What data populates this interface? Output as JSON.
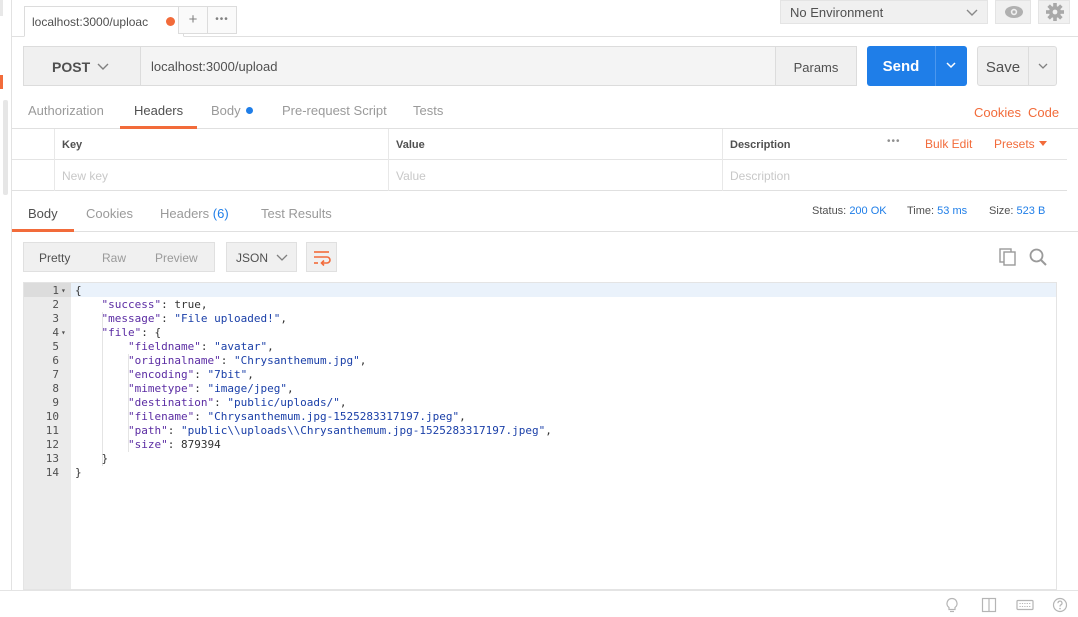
{
  "tabs": {
    "active_tab_label": "localhost:3000/uploac",
    "add_label": "+",
    "more_label": "•••"
  },
  "environment": {
    "selected": "No Environment"
  },
  "request": {
    "method": "POST",
    "url": "localhost:3000/upload",
    "params_label": "Params",
    "send_label": "Send",
    "save_label": "Save"
  },
  "request_tabs": {
    "items": [
      "Authorization",
      "Headers",
      "Body",
      "Pre-request Script",
      "Tests"
    ],
    "cookies_label": "Cookies",
    "code_label": "Code"
  },
  "headers_table": {
    "columns": [
      "Key",
      "Value",
      "Description"
    ],
    "more_label": "•••",
    "bulk_edit_label": "Bulk Edit",
    "presets_label": "Presets",
    "placeholders": [
      "New key",
      "Value",
      "Description"
    ]
  },
  "response_tabs": {
    "body": "Body",
    "cookies": "Cookies",
    "headers": "Headers",
    "headers_count": "(6)",
    "test_results": "Test Results",
    "status_label": "Status:",
    "status_value": "200 OK",
    "time_label": "Time:",
    "time_value": "53 ms",
    "size_label": "Size:",
    "size_value": "523 B"
  },
  "response_toolbar": {
    "modes": [
      "Pretty",
      "Raw",
      "Preview"
    ],
    "format": "JSON"
  },
  "response_body": {
    "lines": [
      "{",
      "    \"success\": true,",
      "    \"message\": \"File uploaded!\",",
      "    \"file\": {",
      "        \"fieldname\": \"avatar\",",
      "        \"originalname\": \"Chrysanthemum.jpg\",",
      "        \"encoding\": \"7bit\",",
      "        \"mimetype\": \"image/jpeg\",",
      "        \"destination\": \"public/uploads/\",",
      "        \"filename\": \"Chrysanthemum.jpg-1525283317197.jpeg\",",
      "        \"path\": \"public\\\\uploads\\\\Chrysanthemum.jpg-1525283317197.jpeg\",",
      "        \"size\": 879394",
      "    }",
      "}"
    ]
  },
  "colors": {
    "accent": "#f26b3a",
    "primary": "#1f7ee8",
    "json_key": "#5b2ca3",
    "json_string": "#1a3fa8"
  },
  "icons": [
    "eye-icon",
    "gear-icon",
    "copy-icon",
    "search-icon",
    "wrap-lines-icon",
    "lightbulb-icon",
    "two-pane-icon",
    "keyboard-icon",
    "help-icon"
  ]
}
